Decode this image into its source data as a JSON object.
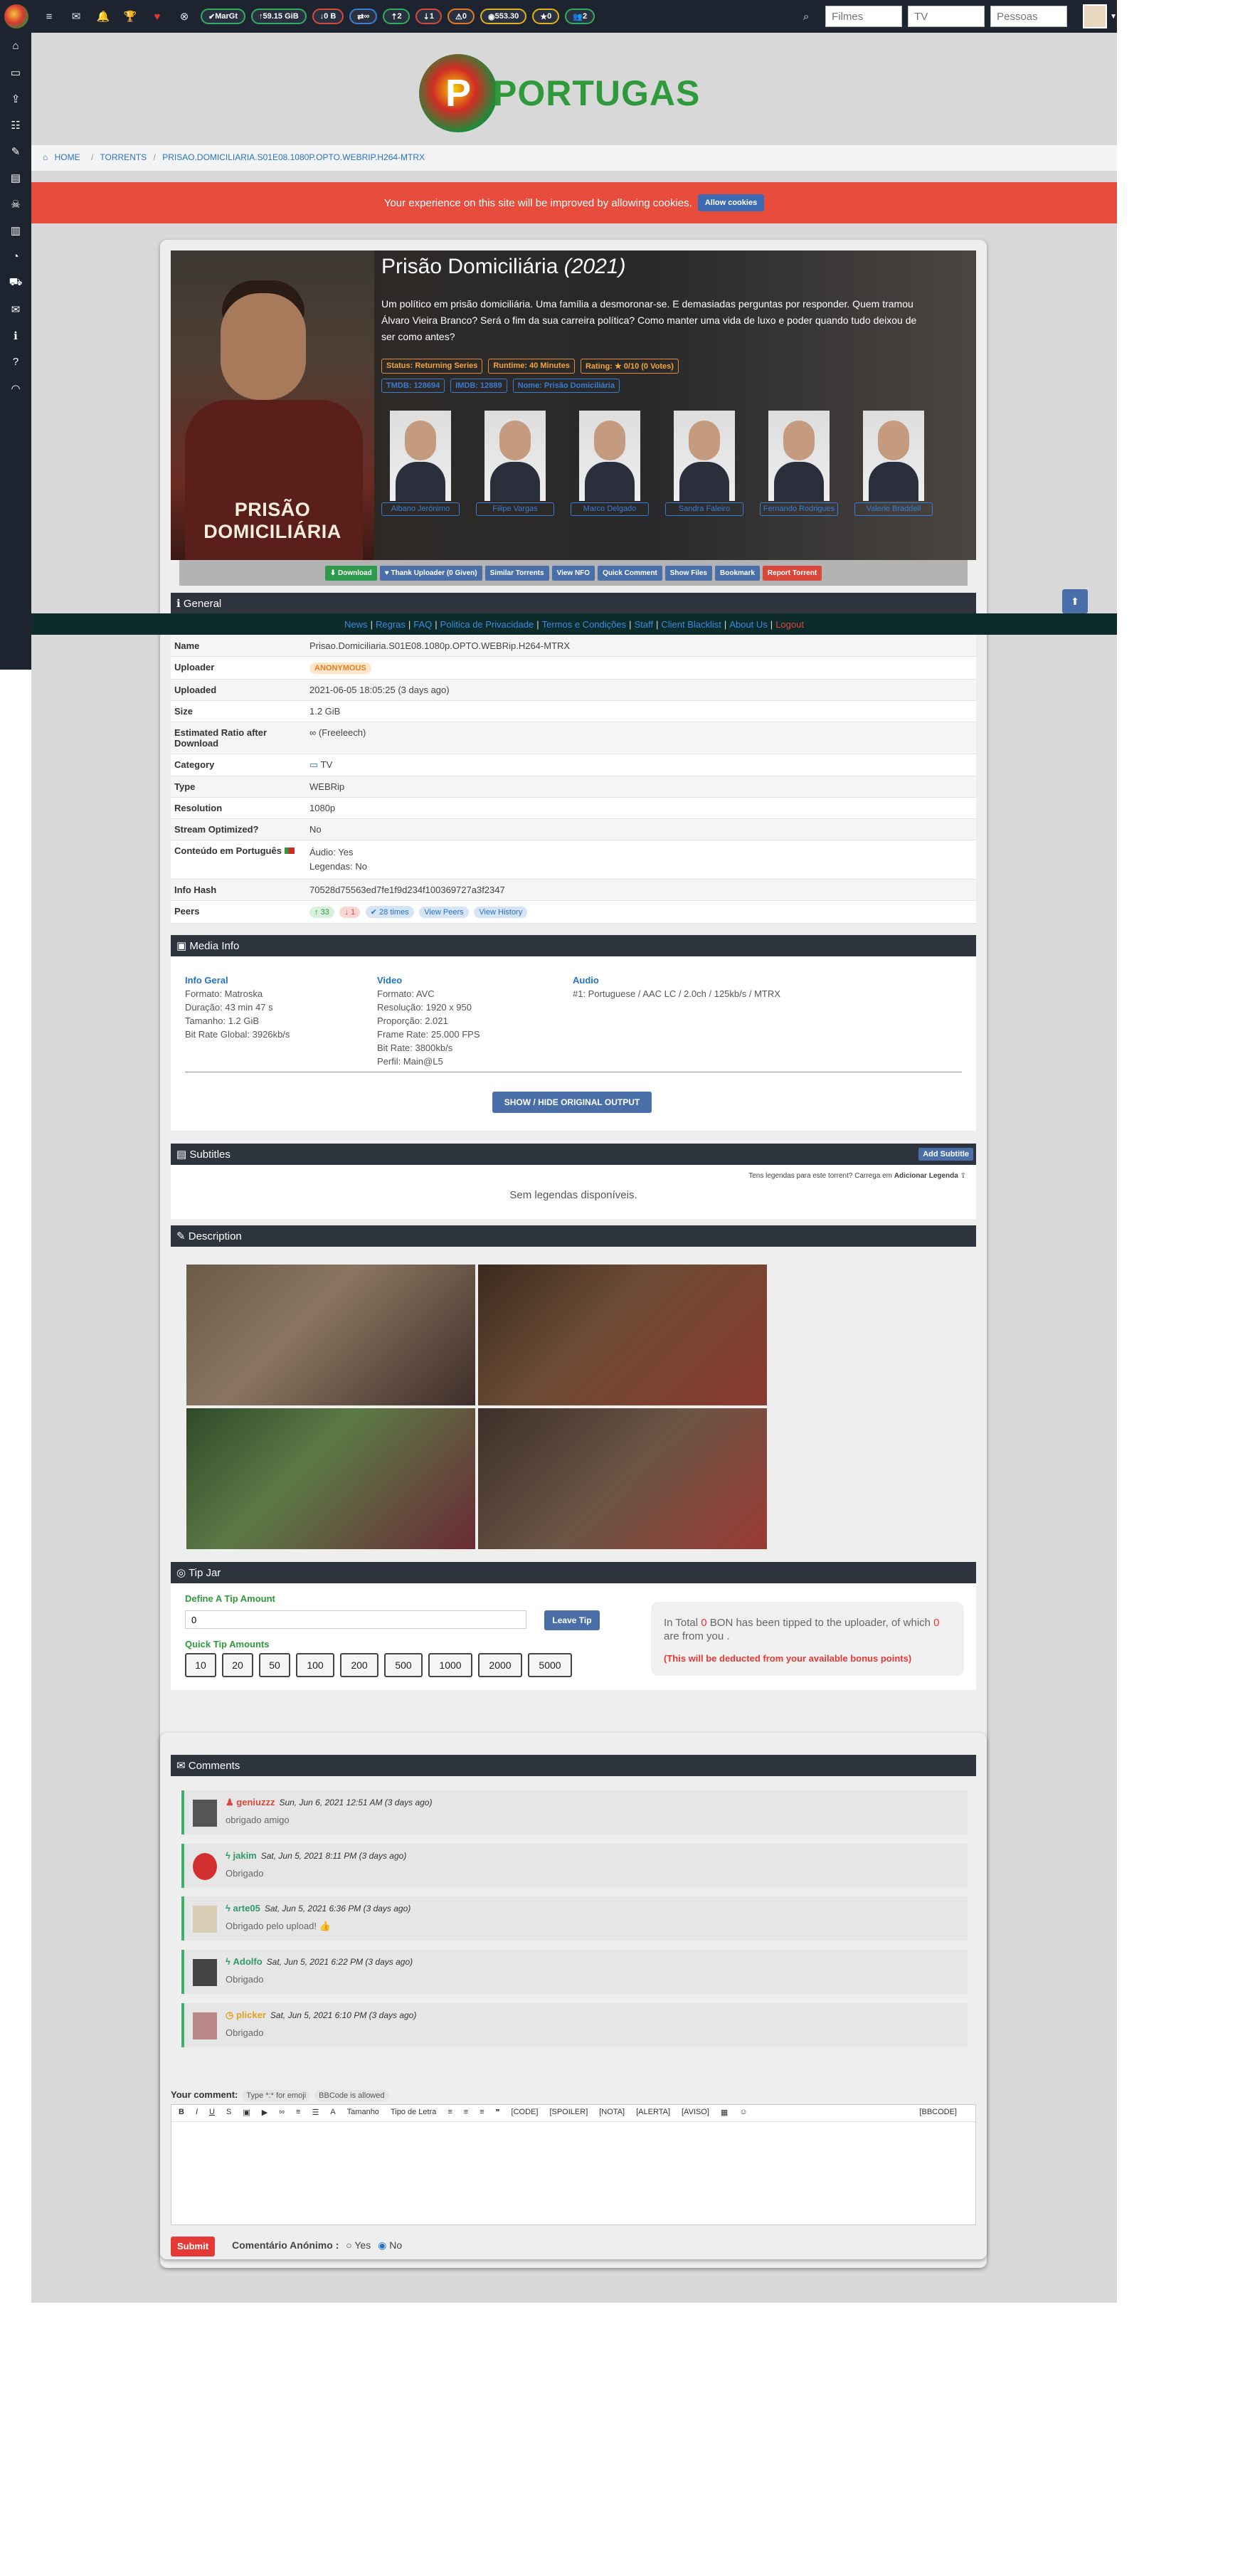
{
  "topbar": {
    "pills": [
      {
        "label": "MarGt",
        "icon": "check-icon",
        "color": "green"
      },
      {
        "label": "59.15 GiB",
        "icon": "up-arrow-icon",
        "color": "green"
      },
      {
        "label": "0 B",
        "icon": "down-arrow-icon",
        "color": "red"
      },
      {
        "label": "∞",
        "icon": "ratio-icon",
        "color": "blue"
      },
      {
        "label": "2",
        "icon": "seeding-icon",
        "color": "green"
      },
      {
        "label": "1",
        "icon": "leeching-icon",
        "color": "red"
      },
      {
        "label": "0",
        "icon": "warning-icon",
        "color": "orange"
      },
      {
        "label": "553.30",
        "icon": "bonus-icon",
        "color": "yellow"
      },
      {
        "label": "0",
        "icon": "star-icon",
        "color": "yellow"
      },
      {
        "label": "2",
        "icon": "users-icon",
        "color": "green"
      }
    ],
    "search_movies": "Filmes",
    "search_tv": "TV",
    "search_people": "Pessoas"
  },
  "brand": {
    "name": "PORTUGAS"
  },
  "breadcrumb": {
    "home": "HOME",
    "torrents": "TORRENTS",
    "current": "PRISAO.DOMICILIARIA.S01E08.1080P.OPTO.WEBRIP.H264-MTRX"
  },
  "cookie": {
    "text": "Your experience on this site will be improved by allowing cookies.",
    "button": "Allow cookies"
  },
  "hero": {
    "poster_title": "PRISÃO DOMICILIÁRIA",
    "title": "Prisão Domiciliária",
    "year": "(2021)",
    "description": "Um político em prisão domiciliária. Uma família a desmoronar-se. E demasiadas perguntas por responder. Quem tramou Álvaro Vieira Branco? Será o fim da sua carreira política? Como manter uma vida de luxo e poder quando tudo deixou de ser como antes?",
    "status": "Status: Returning Series",
    "runtime": "Runtime: 40 Minutes",
    "rating": "Rating: ★ 0/10 (0 Votes)",
    "tmdb": "TMDB: 128694",
    "imdb": "IMDB: 12889",
    "collection": "Nome: Prisão Domiciliária",
    "cast": [
      "Albano Jerónimo",
      "Filipe Vargas",
      "Marco Delgado",
      "Sandra Faleiro",
      "Fernando Rodrigues",
      "Valerie Braddell"
    ]
  },
  "actions": {
    "download": "Download",
    "thank": "Thank Uploader (0 Given)",
    "similar": "Similar Torrents",
    "nfo": "View NFO",
    "quick_comment": "Quick Comment",
    "files": "Show Files",
    "bookmark": "Bookmark",
    "report": "Report Torrent"
  },
  "footer_links": [
    "News",
    "Regras",
    "FAQ",
    "Politica de Privacidade",
    "Termos e Condições",
    "Staff",
    "Client Blacklist",
    "About Us",
    "Logout"
  ],
  "general": {
    "title": "General",
    "rows": [
      {
        "k": "Name",
        "v": "Prisao.Domiciliaria.S01E08.1080p.OPTO.WEBRip.H264-MTRX"
      },
      {
        "k": "Uploader",
        "v": "ANONYMOUS"
      },
      {
        "k": "Uploaded",
        "v": "2021-06-05 18:05:25 (3 days ago)"
      },
      {
        "k": "Size",
        "v": "1.2 GiB"
      },
      {
        "k": "Estimated Ratio after Download",
        "v": "∞ (Freeleech)"
      },
      {
        "k": "Category",
        "v": "TV"
      },
      {
        "k": "Type",
        "v": "WEBRip"
      },
      {
        "k": "Resolution",
        "v": "1080p"
      },
      {
        "k": "Stream Optimized?",
        "v": "No"
      },
      {
        "k": "Conteúdo em Português",
        "v": "Áudio: Yes\nLegendas: No"
      },
      {
        "k": "Info Hash",
        "v": "70528d75563ed7fe1f9d234f100369727a3f2347"
      },
      {
        "k": "Peers",
        "v": ""
      }
    ],
    "peers": {
      "seeders": "33",
      "leechers": "1",
      "times": "28 times",
      "view_peers": "View Peers",
      "view_history": "View History"
    }
  },
  "mediainfo": {
    "title": "Media Info",
    "geral_h": "Info Geral",
    "geral": [
      "Formato: Matroska",
      "Duração: 43 min 47 s",
      "Tamanho: 1.2 GiB",
      "Bit Rate Global: 3926kb/s"
    ],
    "video_h": "Video",
    "video": [
      "Formato: AVC",
      "Resolução: 1920 x 950",
      "Proporção: 2.021",
      "Frame Rate: 25.000 FPS",
      "Bit Rate: 3800kb/s",
      "Perfil: Main@L5"
    ],
    "audio_h": "Audio",
    "audio": [
      "#1: Portuguese / AAC LC / 2.0ch / 125kb/s / MTRX"
    ],
    "button": "SHOW / HIDE ORIGINAL OUTPUT"
  },
  "subtitles": {
    "title": "Subtitles",
    "add": "Add Subtitle",
    "hint": "Tens legendas para este torrent? Carrega em",
    "hint_link": "Adicionar Legenda",
    "none": "Sem legendas disponíveis."
  },
  "description": {
    "title": "Description"
  },
  "tip": {
    "title": "Tip Jar",
    "define": "Define A Tip Amount",
    "value": "0",
    "leave": "Leave Tip",
    "quick": "Quick Tip Amounts",
    "amounts": [
      "10",
      "20",
      "50",
      "100",
      "200",
      "500",
      "1000",
      "2000",
      "5000"
    ],
    "info_pre": "In Total",
    "info_total": "0",
    "info_mid": "BON has been tipped to the uploader, of which",
    "info_you": "0",
    "info_post": "are from you .",
    "warn": "(This will be deducted from your available bonus points)"
  },
  "comments": {
    "title": "Comments",
    "items": [
      {
        "user": "geniuzzz",
        "date": "Sun, Jun 6, 2021 12:51 AM (3 days ago)",
        "text": "obrigado amigo",
        "color": "#d9483b"
      },
      {
        "user": "jakim",
        "date": "Sat, Jun 5, 2021 8:11 PM (3 days ago)",
        "text": "Obrigado",
        "color": "#2e9a6a"
      },
      {
        "user": "arte05",
        "date": "Sat, Jun 5, 2021 6:36 PM (3 days ago)",
        "text": "Obrigado pelo upload! 👍",
        "color": "#2e9a6a"
      },
      {
        "user": "Adolfo",
        "date": "Sat, Jun 5, 2021 6:22 PM (3 days ago)",
        "text": "Obrigado",
        "color": "#2e9a6a"
      },
      {
        "user": "plicker",
        "date": "Sat, Jun 5, 2021 6:10 PM (3 days ago)",
        "text": "Obrigado",
        "color": "#e0a21a"
      }
    ]
  },
  "editor": {
    "label": "Your comment:",
    "hint1": "Type *:* for emoji",
    "hint2": "BBCode is allowed",
    "tools": [
      "B",
      "I",
      "U",
      "S",
      "▣",
      "▶",
      "∞",
      "≡",
      "☰",
      "A",
      "Tamanho",
      "Tipo de Letra",
      "≡",
      "≡",
      "≡",
      "❞",
      "[CODE]",
      "[SPOILER]",
      "[NOTA]",
      "[ALERTA]",
      "[AVISO]",
      "▦",
      "☺",
      "[BBCODE]"
    ],
    "submit": "Submit",
    "anon_label": "Comentário Anónimo :",
    "yes": "Yes",
    "no": "No"
  }
}
